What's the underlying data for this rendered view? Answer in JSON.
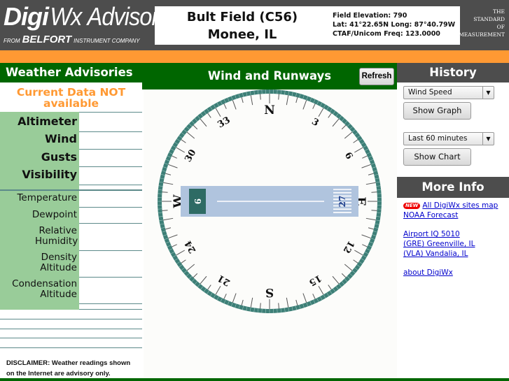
{
  "header": {
    "logo_prefix": "Digi",
    "logo_mid": "Wx",
    "logo_suffix": " Advisor",
    "trademark": "™",
    "from": "FROM",
    "company_brand": "BELFORT",
    "company_rest": "INSTRUMENT COMPANY",
    "field_name": "Bult Field (C56)",
    "field_location": "Monee, IL",
    "elevation": "Field Elevation: 790",
    "latlong": "Lat: 41°22.65N  Long: 87°40.79W",
    "freq": "CTAF/Unicom Freq: 123.0000",
    "tagline": [
      "THE",
      "STANDARD",
      "OF",
      "MEASUREMENT"
    ]
  },
  "colors": {
    "green": "#006600",
    "orange": "#ff9933",
    "gray": "#4d4d4d",
    "label_green": "#99cc99",
    "runway": "#b0c4de",
    "runway_end": "#2e6b64",
    "ring": "#3d7f77"
  },
  "advisories": {
    "title": "Weather Advisories",
    "status": "Current Data  NOT available",
    "rows_primary": [
      {
        "label": "Altimeter",
        "value": ""
      },
      {
        "label": "Wind",
        "value": ""
      },
      {
        "label": "Gusts",
        "value": ""
      },
      {
        "label": "Visibility",
        "value": ""
      }
    ],
    "rows_secondary": [
      {
        "label": "Temperature",
        "value": ""
      },
      {
        "label": "Dewpoint",
        "value": ""
      },
      {
        "label": "Relative Humidity",
        "value": ""
      },
      {
        "label": "Density Altitude",
        "value": ""
      },
      {
        "label": "Condensation Altitude",
        "value": ""
      }
    ],
    "disclaimer_line1": "DISCLAIMER: Weather readings shown",
    "disclaimer_line2": "on the Internet are advisory only."
  },
  "center": {
    "title": "Wind and Runways",
    "refresh_label": "Refresh",
    "compass": {
      "cardinals": {
        "N": "N",
        "E": "E",
        "S": "S",
        "W": "W"
      },
      "numbers": [
        {
          "label": "3",
          "deg": 30
        },
        {
          "label": "6",
          "deg": 60
        },
        {
          "label": "12",
          "deg": 120
        },
        {
          "label": "15",
          "deg": 150
        },
        {
          "label": "21",
          "deg": 210
        },
        {
          "label": "24",
          "deg": 240
        },
        {
          "label": "30",
          "deg": 300
        },
        {
          "label": "33",
          "deg": 330
        }
      ],
      "runway": {
        "end_a": "9",
        "end_b": "27",
        "heading_deg": 90
      }
    }
  },
  "history": {
    "title": "History",
    "param_select": "Wind Speed",
    "show_graph": "Show Graph",
    "period_select": "Last 60 minutes",
    "show_chart": "Show Chart"
  },
  "more_info": {
    "title": "More Info",
    "new_badge": "NEW",
    "links": [
      "All DigiWx sites map",
      "NOAA Forecast",
      "Airport IQ 5010",
      "(GRE) Greenville, IL",
      "(VLA) Vandalia, IL",
      "about DigiWx"
    ]
  }
}
